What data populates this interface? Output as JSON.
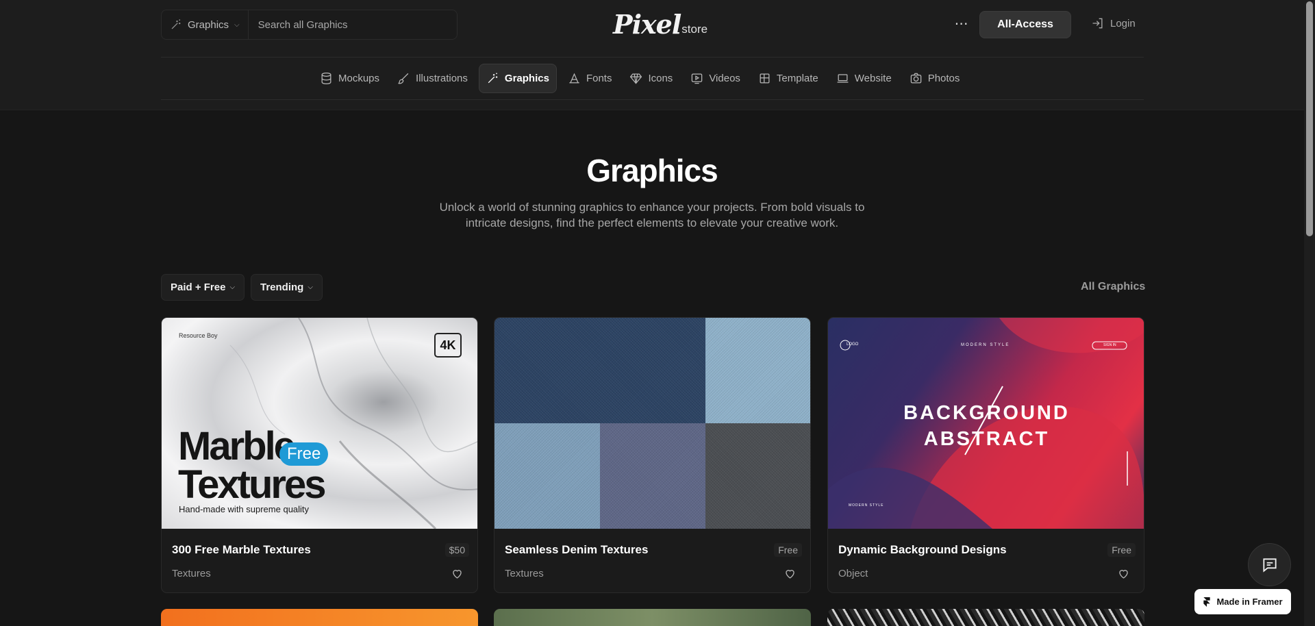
{
  "header": {
    "category_select": "Graphics",
    "search_placeholder": "Search all Graphics",
    "logo_main": "Pixel",
    "logo_sub": "store",
    "more_label": "⋯",
    "all_access_label": "All-Access",
    "login_label": "Login"
  },
  "nav": [
    {
      "label": "Mockups",
      "icon": "database-icon"
    },
    {
      "label": "Illustrations",
      "icon": "brush-icon"
    },
    {
      "label": "Graphics",
      "icon": "magic-wand-icon",
      "active": true
    },
    {
      "label": "Fonts",
      "icon": "font-icon"
    },
    {
      "label": "Icons",
      "icon": "diamond-icon"
    },
    {
      "label": "Videos",
      "icon": "video-icon"
    },
    {
      "label": "Template",
      "icon": "grid-icon"
    },
    {
      "label": "Website",
      "icon": "laptop-icon"
    },
    {
      "label": "Photos",
      "icon": "camera-icon"
    }
  ],
  "hero": {
    "title": "Graphics",
    "subtitle": "Unlock a world of stunning graphics to enhance your projects. From bold visuals to intricate designs, find the perfect elements to elevate your creative work."
  },
  "filters": {
    "pricing": "Paid + Free",
    "sort": "Trending",
    "all_link": "All Graphics"
  },
  "cards": [
    {
      "title": "300 Free Marble Textures",
      "price": "$50",
      "category": "Textures",
      "thumb": {
        "corner": "Resource Boy",
        "badge": "4K",
        "headline_1": "Marble",
        "headline_2": "Textures",
        "pill": "Free",
        "tagline": "Hand-made with supreme quality"
      }
    },
    {
      "title": "Seamless Denim Textures",
      "price": "Free",
      "category": "Textures",
      "swatches": [
        "#2c4363",
        "#2f4766",
        "#8fb1c9",
        "#7f9fba",
        "#5f6787",
        "#4b4e52"
      ]
    },
    {
      "title": "Dynamic Background Designs",
      "price": "Free",
      "category": "Object",
      "thumb": {
        "line_1": "BACKGROUND",
        "line_2": "ABSTRACT",
        "logo": "LOGO",
        "style": "MODERN STYLE",
        "button": "SIGN IN",
        "footer_style": "MODERN STYLE"
      }
    }
  ],
  "floating": {
    "made_in_framer": "Made in Framer"
  },
  "colors": {
    "background": "#161616",
    "header": "#1d1d1d",
    "accent_free": "#1f9ad6"
  }
}
